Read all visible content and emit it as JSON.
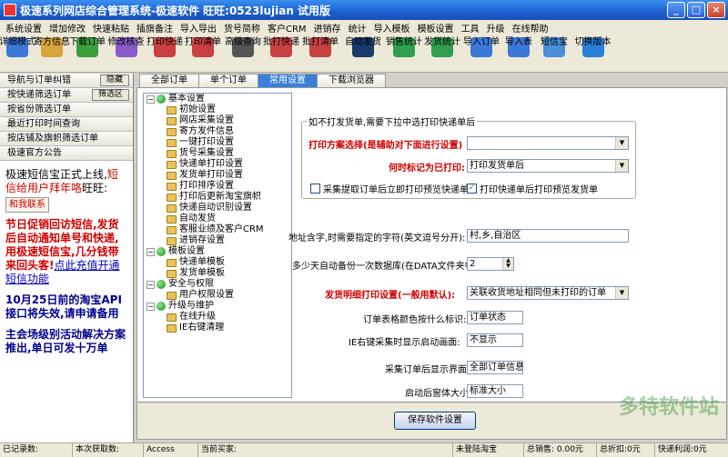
{
  "window": {
    "title": "极速系列网店综合管理系统-极速软件 旺旺:0523lujian 试用版",
    "min": "_",
    "max": "□",
    "close": "×"
  },
  "menu": [
    "系统设置",
    "增加修改",
    "快速粘贴",
    "插旗备注",
    "导入导出",
    "货号简称",
    "客户CRM",
    "进销存",
    "统计",
    "导入模板",
    "模板设置",
    "工具",
    "升级",
    "在线帮助"
  ],
  "toolbar": [
    {
      "label": "详细模式",
      "icon": "detail-mode-icon",
      "color": "#3b78d8"
    },
    {
      "label": "寄方信息",
      "icon": "sender-info-icon",
      "color": "#d8a43b"
    },
    {
      "label": "下载订单",
      "icon": "download-order-icon",
      "color": "#3b9e3b"
    },
    {
      "label": "修改核查",
      "icon": "edit-check-icon",
      "color": "#8a5bc8"
    },
    {
      "label": "打印快递",
      "icon": "print-express-icon",
      "color": "#c84040"
    },
    {
      "label": "打印清单",
      "icon": "print-list-icon",
      "color": "#c84040"
    },
    {
      "label": "高级查询",
      "icon": "advanced-query-icon",
      "color": "#555555"
    },
    {
      "label": "批打快递",
      "icon": "batch-print-express-icon",
      "color": "#c84040"
    },
    {
      "label": "批打清单",
      "icon": "batch-print-list-icon",
      "color": "#c84040"
    },
    {
      "label": "自动发货",
      "icon": "auto-ship-icon",
      "color": "#1a3a6e"
    },
    {
      "label": "销售统计",
      "icon": "sales-stats-icon",
      "color": "#2f9e4f"
    },
    {
      "label": "发货统计",
      "icon": "ship-stats-icon",
      "color": "#2f9e4f"
    },
    {
      "label": "导入订单",
      "icon": "import-order-icon",
      "color": "#3b78d8"
    },
    {
      "label": "导入表",
      "icon": "import-table-icon",
      "color": "#3b78d8"
    },
    {
      "label": "短信宝",
      "icon": "sms-icon",
      "color": "#4a8fd8"
    },
    {
      "label": "切换版本",
      "icon": "switch-version-icon",
      "color": "#2a7fd8"
    }
  ],
  "sidebar": {
    "rows": [
      {
        "label": "导航与订单纠错",
        "button": "隐藏"
      },
      {
        "label": "按快递筛选订单",
        "button": "筛选区"
      },
      {
        "label": "按省份筛选订单"
      },
      {
        "label": "最近打印时间查询"
      },
      {
        "label": "按店铺及旗帜筛选订单"
      },
      {
        "label": "极速官方公告"
      }
    ],
    "bulletin": {
      "p1_a": "极速短信宝正式上线,",
      "p1_b": "短信给用户拜年咯",
      "p1_c": "旺旺:",
      "contact": "和我联系",
      "p2_a": "节日促销回访短信,发货后自动通知单号和快递,用极速短信宝,几分钱带来回头客!",
      "p2_b": "点此充值开通短信功能",
      "p3": "10月25日前的淘宝API接口将失效,请申请备用",
      "p4": "主会场级别活动解决方案推出,单日可发十万单"
    }
  },
  "tabs": [
    "全部订单",
    "单个订单",
    "常用设置",
    "下载浏览器"
  ],
  "active_tab": 2,
  "tree": [
    {
      "type": "root",
      "label": "基本设置"
    },
    {
      "type": "child",
      "label": "初始设置"
    },
    {
      "type": "child",
      "label": "网店采集设置"
    },
    {
      "type": "child",
      "label": "寄方发件信息"
    },
    {
      "type": "child",
      "label": "一键打印设置"
    },
    {
      "type": "child",
      "label": "货号采集设置"
    },
    {
      "type": "child",
      "label": "快递单打印设置"
    },
    {
      "type": "child",
      "label": "发货单打印设置"
    },
    {
      "type": "child",
      "label": "打印排序设置"
    },
    {
      "type": "child",
      "label": "打印后更新淘宝旗帜"
    },
    {
      "type": "child",
      "label": "快递自动识别设置"
    },
    {
      "type": "child",
      "label": "自动发货"
    },
    {
      "type": "child",
      "label": "客服业绩及客户CRM"
    },
    {
      "type": "child",
      "label": "进销存设置"
    },
    {
      "type": "root",
      "label": "模板设置"
    },
    {
      "type": "child",
      "label": "快递单模板"
    },
    {
      "type": "child",
      "label": "发货单模板"
    },
    {
      "type": "root",
      "label": "安全与权限"
    },
    {
      "type": "child",
      "label": "用户权限设置"
    },
    {
      "type": "root",
      "label": "升级与维护"
    },
    {
      "type": "child",
      "label": "在线升级"
    },
    {
      "type": "child",
      "label": "IE右键清理"
    }
  ],
  "form": {
    "group_label": "如不打发货单,需要下拉中选打印快递单后",
    "print_scheme_label": "打印方案选择(是辅助对下面进行设置)",
    "print_scheme_value": "",
    "mark_printed_label": "何时标记为已打印:",
    "mark_printed_value": "打印发货单后",
    "chk_preview_label": "采集提取订单后立即打印预览快递单",
    "chk_preview_checked": false,
    "chk_after_ship_label": "打印快递单后打印预览发货单",
    "chk_after_ship_checked": true,
    "address_label": "地址含字,时需要指定的字符(英文逗号分开):",
    "address_value": "村,乡,自治区",
    "backup_label": "多少天自动备份一次数据库(在DATA文件夹中):",
    "backup_value": "2",
    "detail_print_label": "发货明细打印设置(一般用默认):",
    "detail_print_value": "关联收货地址相同但未打印的订单",
    "row_color_label": "订单表格颜色按什么标识:",
    "row_color_value": "订单状态",
    "ie_label": "IE右键采集时显示启动画面:",
    "ie_value": "不显示",
    "collect_view_label": "采集订单后显示界面",
    "collect_view_value": "全部订单信息",
    "window_size_label": "启动后窗体大小",
    "window_size_value": "标准大小"
  },
  "save_button": "保存软件设置",
  "status": [
    {
      "label": "已记录数:",
      "value": ""
    },
    {
      "label": "本次获取数:",
      "value": ""
    },
    {
      "label": "Access",
      "value": ""
    },
    {
      "label": "当前买家:",
      "value": ""
    },
    {
      "label": "未登陆淘宝",
      "value": ""
    },
    {
      "label": "总销售: 0.00元",
      "value": ""
    },
    {
      "label": "总折扣:0元",
      "value": ""
    },
    {
      "label": "快递利润:0元",
      "value": ""
    }
  ],
  "watermark": "多特软件站"
}
